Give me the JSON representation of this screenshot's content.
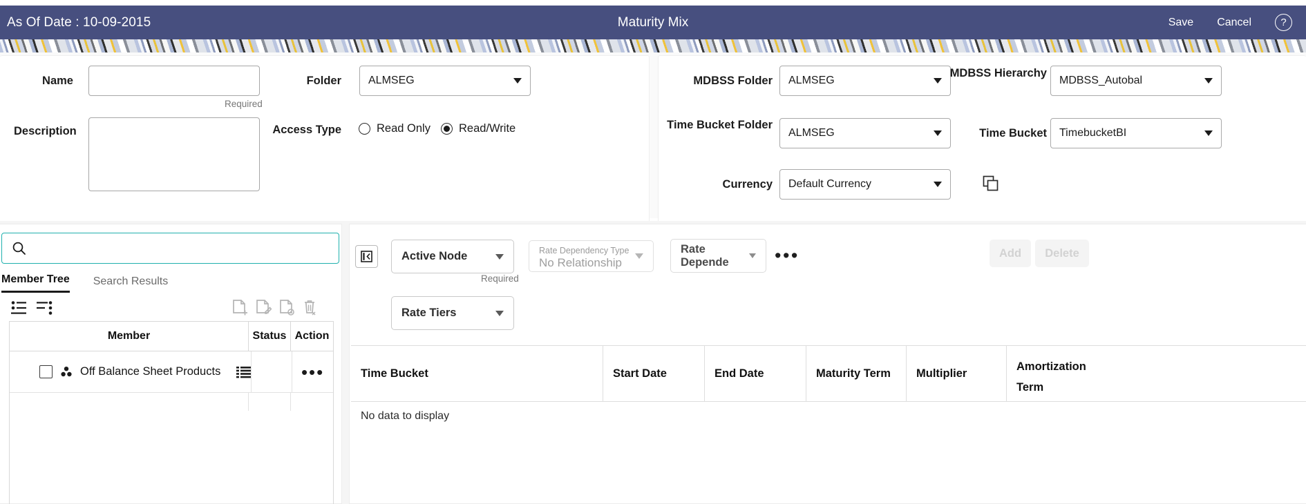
{
  "header": {
    "as_of_date_label": "As Of Date : 10-09-2015",
    "title": "Maturity Mix",
    "save_label": "Save",
    "cancel_label": "Cancel",
    "help_glyph": "?",
    "bg_color": "#474f7f"
  },
  "form": {
    "name_label": "Name",
    "name_value": "",
    "name_required_hint": "Required",
    "description_label": "Description",
    "description_value": "",
    "folder_label": "Folder",
    "folder_value": "ALMSEG",
    "access_type_label": "Access Type",
    "access_read_only_label": "Read Only",
    "access_read_write_label": "Read/Write",
    "access_selected": "Read/Write",
    "mdbss_folder_label": "MDBSS Folder",
    "mdbss_folder_value": "ALMSEG",
    "mdbss_hierarchy_label": "MDBSS Hierarchy",
    "mdbss_hierarchy_value": "MDBSS_Autobal",
    "time_bucket_folder_label": "Time Bucket Folder",
    "time_bucket_folder_value": "ALMSEG",
    "time_bucket_label": "Time Bucket",
    "time_bucket_value": "TimebucketBI",
    "currency_label": "Currency",
    "currency_value": "Default Currency",
    "copy_icon": "copy-icon"
  },
  "tree_panel": {
    "search_placeholder": "",
    "search_value": "",
    "search_icon": "search-icon",
    "focus_color": "#1eb0ad",
    "tabs": [
      {
        "label": "Member Tree",
        "active": true
      },
      {
        "label": "Search Results",
        "active": false
      }
    ],
    "toolbar_icons": [
      "expand-all-icon",
      "collapse-all-icon",
      "add-document-icon",
      "edit-document-icon",
      "view-document-icon",
      "delete-document-icon"
    ],
    "columns": [
      "Member",
      "Status",
      "Action"
    ],
    "rows": [
      {
        "member": "Off Balance Sheet Products",
        "node_icon": "hierarchy-node-icon",
        "list_icon": "list-icon",
        "checked": false,
        "status": "",
        "action": "…"
      }
    ]
  },
  "rate_panel": {
    "collapse_icon": "collapse-panel-icon",
    "active_node_value": "Active Node",
    "active_node_required_hint": "Required",
    "rate_dependency_type_label": "Rate Dependency Type",
    "rate_dependency_type_value": "No Relationship",
    "rate_dependency_value": "Rate Depende",
    "more_options_glyph": "•••",
    "rate_tiers_value": "Rate Tiers",
    "add_label": "Add",
    "delete_label": "Delete"
  },
  "grid": {
    "columns": [
      "Time Bucket",
      "Start Date",
      "End Date",
      "Maturity Term",
      "Multiplier",
      "Amortization Term"
    ],
    "empty_text": "No data to display"
  }
}
